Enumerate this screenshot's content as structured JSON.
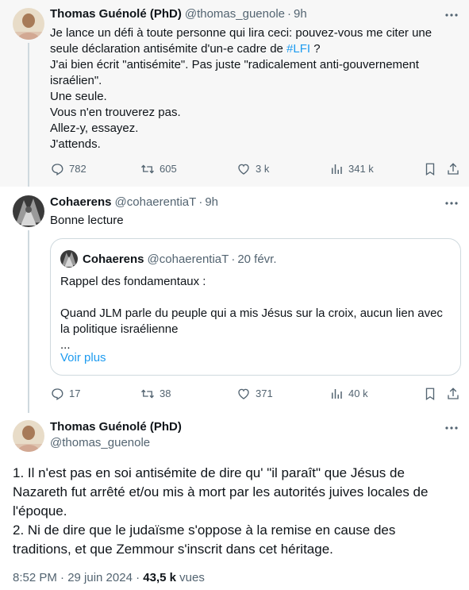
{
  "tweet1": {
    "name": "Thomas Guénolé (PhD)",
    "handle": "@thomas_guenole",
    "separator": "·",
    "time": "9h",
    "lines": [
      "Je lance un défi à toute personne qui lira ceci: pouvez-vous me citer une",
      "seule déclaration antisémite d'un-e cadre de ",
      "J'ai bien écrit \"antisémite\". Pas juste \"radicalement anti-gouvernement",
      "israélien\".",
      "Une seule.",
      "Vous n'en trouverez pas.",
      "Allez-y, essayez.",
      "J'attends."
    ],
    "hashtag": "#LFI",
    "hashtag_suffix": " ?",
    "replies": "782",
    "retweets": "605",
    "likes": "3 k",
    "views": "341 k"
  },
  "tweet2": {
    "name": "Cohaerens",
    "handle": "@cohaerentiaT",
    "separator": "·",
    "time": "9h",
    "text": "Bonne lecture",
    "quote": {
      "name": "Cohaerens",
      "handle": "@cohaerentiaT",
      "separator": "·",
      "date": "20 févr.",
      "line1": "Rappel des fondamentaux :",
      "line2": "Quand JLM parle du peuple qui a mis Jésus sur la croix, aucun lien avec",
      "line3": "la politique israélienne",
      "line4": "...",
      "more_link": "Voir plus"
    },
    "replies": "17",
    "retweets": "38",
    "likes": "371",
    "views": "40 k"
  },
  "tweet3": {
    "name": "Thomas Guénolé (PhD)",
    "handle": "@thomas_guenole",
    "paragraph1": [
      "1. Il n'est pas en soi antisémite de dire qu' \"il paraît\" que Jésus de",
      "Nazareth fut arrêté et/ou mis à mort par les autorités juives locales de",
      "l'époque."
    ],
    "paragraph2": [
      "2. Ni de dire que le judaïsme s'oppose à la remise en cause des",
      "traditions, et que Zemmour s'inscrit dans cet héritage."
    ],
    "timestamp": "8:52 PM · 29 juin 2024 · ",
    "views_count": "43,5 k",
    "views_label": " vues"
  },
  "icons": {
    "more": "more-horizontal-icon",
    "reply": "reply-icon",
    "retweet": "retweet-icon",
    "like": "heart-icon",
    "views": "views-icon",
    "bookmark": "bookmark-icon",
    "share": "share-icon"
  },
  "colors": {
    "accent": "#1d9bf0",
    "secondary_text": "#536471",
    "border": "#cfd9de",
    "highlight_bg": "#f7f7f7"
  }
}
